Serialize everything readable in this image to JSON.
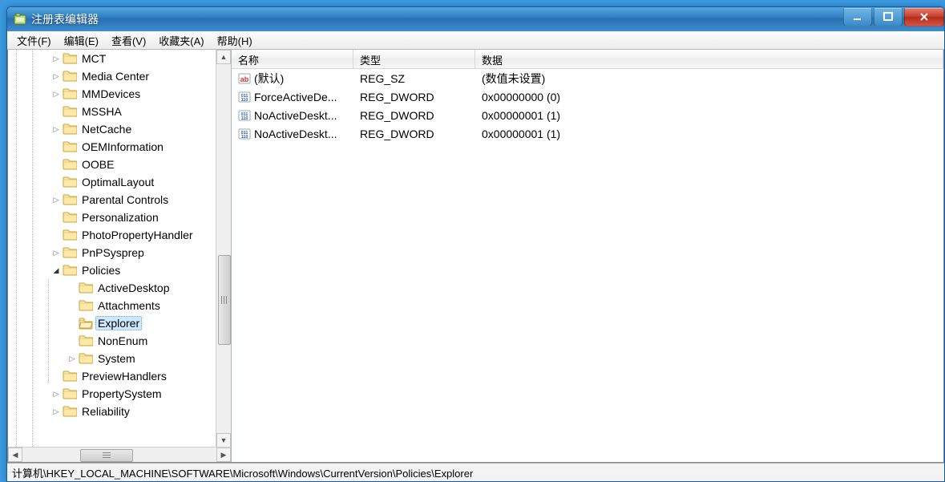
{
  "titlebar": {
    "title": "注册表编辑器"
  },
  "menu": {
    "file": "文件(F)",
    "edit": "编辑(E)",
    "view": "查看(V)",
    "fav": "收藏夹(A)",
    "help": "帮助(H)"
  },
  "tree": {
    "items": [
      {
        "depth": 5,
        "expander": "closed",
        "label": "MCT"
      },
      {
        "depth": 5,
        "expander": "closed",
        "label": "Media Center"
      },
      {
        "depth": 5,
        "expander": "closed",
        "label": "MMDevices"
      },
      {
        "depth": 5,
        "expander": "none",
        "label": "MSSHA"
      },
      {
        "depth": 5,
        "expander": "closed",
        "label": "NetCache"
      },
      {
        "depth": 5,
        "expander": "none",
        "label": "OEMInformation"
      },
      {
        "depth": 5,
        "expander": "none",
        "label": "OOBE"
      },
      {
        "depth": 5,
        "expander": "none",
        "label": "OptimalLayout"
      },
      {
        "depth": 5,
        "expander": "closed",
        "label": "Parental Controls"
      },
      {
        "depth": 5,
        "expander": "none",
        "label": "Personalization"
      },
      {
        "depth": 5,
        "expander": "none",
        "label": "PhotoPropertyHandler"
      },
      {
        "depth": 5,
        "expander": "closed",
        "label": "PnPSysprep"
      },
      {
        "depth": 5,
        "expander": "open",
        "label": "Policies"
      },
      {
        "depth": 6,
        "expander": "none",
        "label": "ActiveDesktop"
      },
      {
        "depth": 6,
        "expander": "none",
        "label": "Attachments"
      },
      {
        "depth": 6,
        "expander": "none",
        "label": "Explorer",
        "selected": true,
        "openFolder": true
      },
      {
        "depth": 6,
        "expander": "none",
        "label": "NonEnum"
      },
      {
        "depth": 6,
        "expander": "closed",
        "label": "System"
      },
      {
        "depth": 5,
        "expander": "none",
        "label": "PreviewHandlers"
      },
      {
        "depth": 5,
        "expander": "closed",
        "label": "PropertySystem"
      },
      {
        "depth": 5,
        "expander": "closed",
        "label": "Reliability"
      }
    ]
  },
  "list": {
    "headers": {
      "name": "名称",
      "type": "类型",
      "data": "数据"
    },
    "rows": [
      {
        "icon": "string",
        "name": "(默认)",
        "type": "REG_SZ",
        "data": "(数值未设置)"
      },
      {
        "icon": "binary",
        "name": "ForceActiveDe...",
        "type": "REG_DWORD",
        "data": "0x00000000 (0)"
      },
      {
        "icon": "binary",
        "name": "NoActiveDeskt...",
        "type": "REG_DWORD",
        "data": "0x00000001 (1)"
      },
      {
        "icon": "binary",
        "name": "NoActiveDeskt...",
        "type": "REG_DWORD",
        "data": "0x00000001 (1)"
      }
    ]
  },
  "statusbar": {
    "path": "计算机\\HKEY_LOCAL_MACHINE\\SOFTWARE\\Microsoft\\Windows\\CurrentVersion\\Policies\\Explorer"
  }
}
